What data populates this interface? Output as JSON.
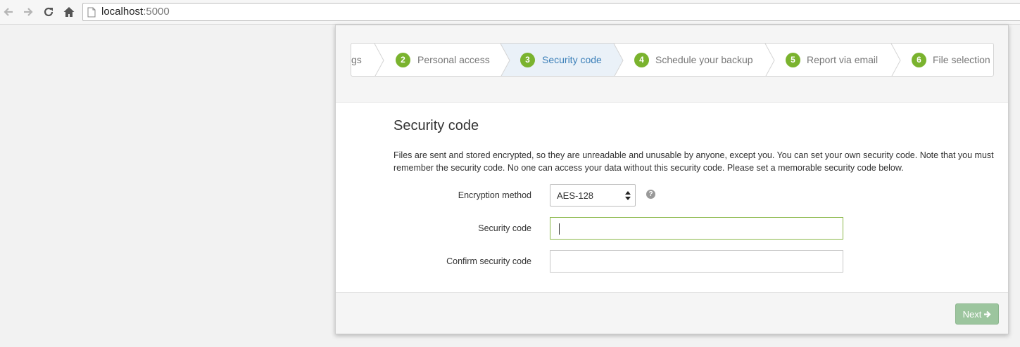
{
  "browser": {
    "url_host": "localhost",
    "url_port": ":5000"
  },
  "wizard": {
    "steps": [
      {
        "number": "",
        "label": "gs"
      },
      {
        "number": "2",
        "label": "Personal access"
      },
      {
        "number": "3",
        "label": "Security code",
        "active": true
      },
      {
        "number": "4",
        "label": "Schedule your backup"
      },
      {
        "number": "5",
        "label": "Report via email"
      },
      {
        "number": "6",
        "label": "File selection"
      }
    ]
  },
  "form": {
    "title": "Security code",
    "description": "Files are sent and stored encrypted, so they are unreadable and unusable by anyone, except you. You can set your own security code. Note that you must remember the security code. No one can access your data without this security code. Please set a memorable security code below.",
    "encryption_label": "Encryption method",
    "encryption_value": "AES-128",
    "help_glyph": "?",
    "security_code_label": "Security code",
    "security_code_value": "",
    "confirm_label": "Confirm security code",
    "confirm_value": ""
  },
  "footer": {
    "next_label": "Next"
  },
  "colors": {
    "step_badge": "#7ab32e",
    "active_step_text": "#3b7fb8",
    "next_button": "#9cc59e"
  }
}
